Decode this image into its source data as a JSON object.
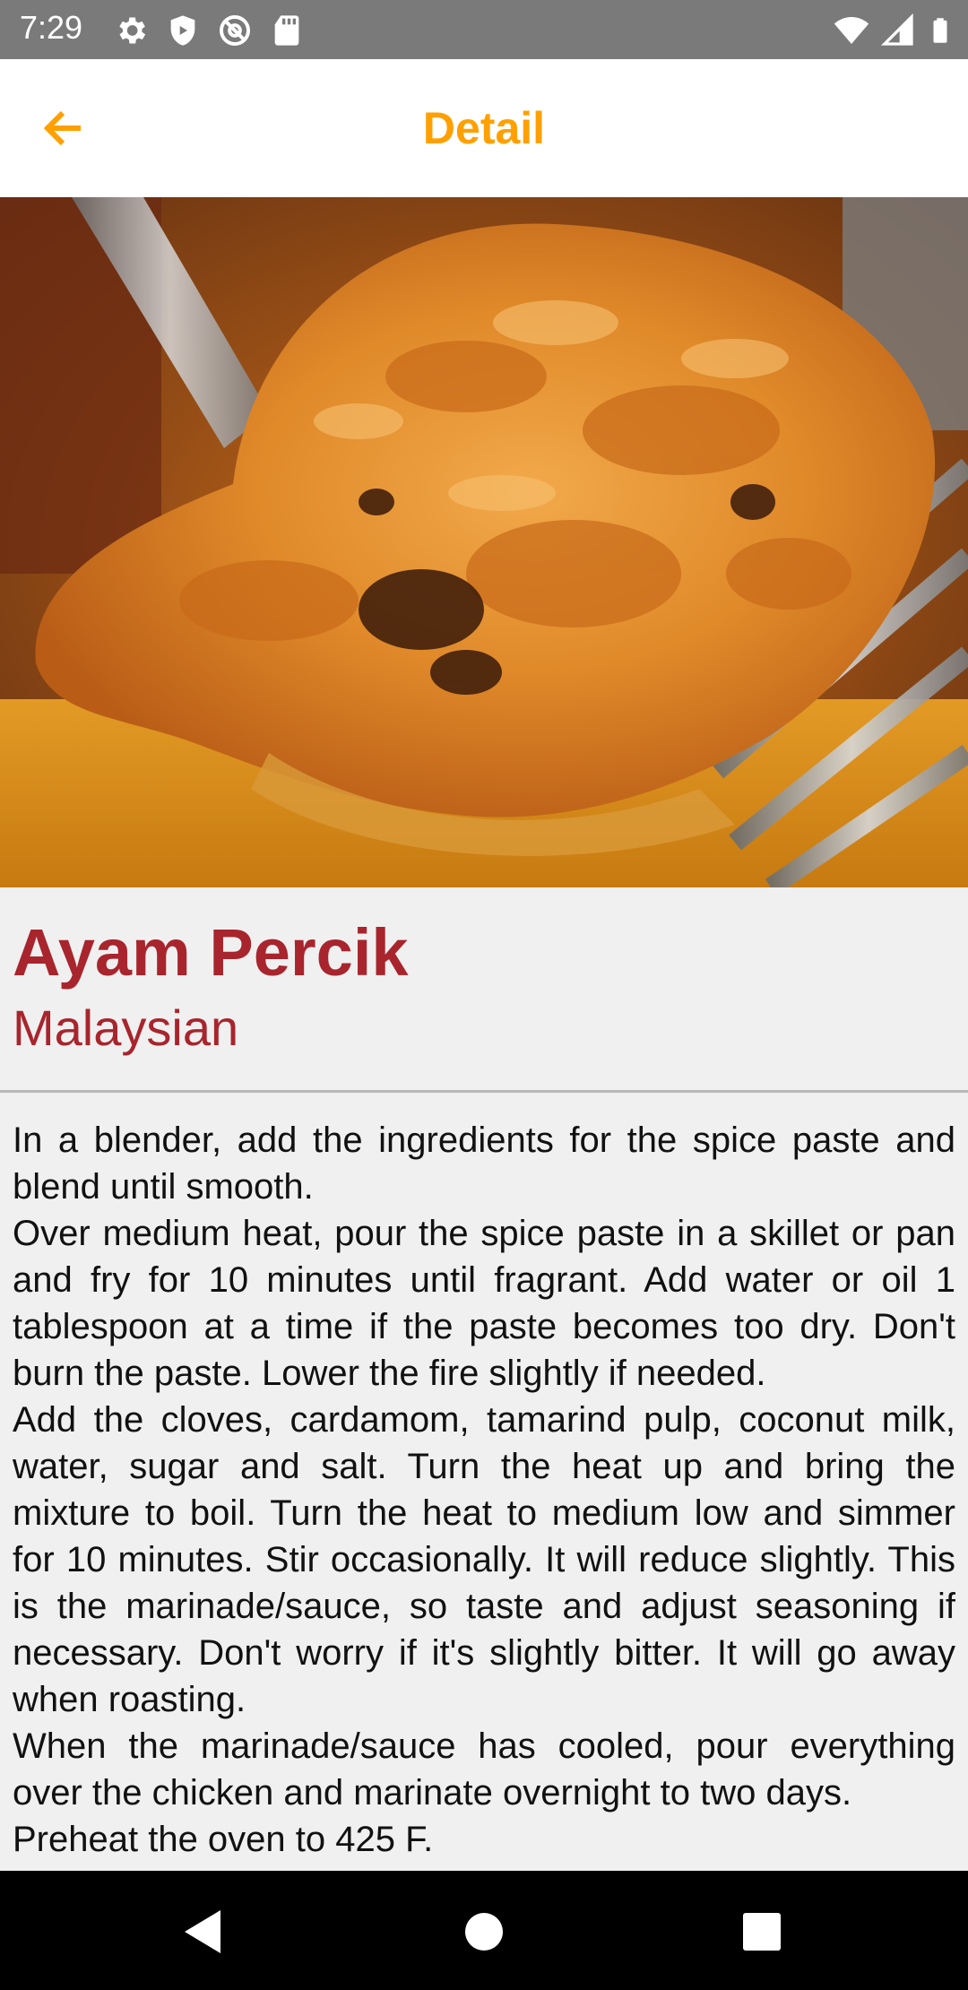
{
  "status_bar": {
    "time": "7:29",
    "left_icons": [
      "gear-icon",
      "shield-icon",
      "at-sign-icon",
      "sd-card-icon"
    ],
    "right_icons": [
      "wifi-icon",
      "cell-signal-icon",
      "battery-icon"
    ]
  },
  "app_bar": {
    "title": "Detail",
    "back_icon": "arrow-left-icon",
    "accent_color": "#ffa000"
  },
  "meal": {
    "name": "Ayam Percik",
    "area": "Malaysian",
    "title_color": "#a8252d",
    "image_description_icon": "food-photo"
  },
  "instructions": {
    "paragraphs": [
      "In a blender, add the ingredients for the spice paste and blend until smooth.",
      "Over medium heat, pour the spice paste in a skillet or pan and fry for 10 minutes until fragrant. Add water or oil 1 tablespoon at a time if the paste becomes too dry. Don't burn the paste. Lower the fire slightly if needed.",
      "Add the cloves, cardamom, tamarind pulp, coconut milk, water, sugar and salt. Turn the heat up and bring the mixture to boil. Turn the heat to medium low and simmer for 10 minutes. Stir occasionally. It will reduce slightly. This is the marinade/sauce, so taste and adjust seasoning if necessary. Don't worry if it's slightly bitter. It will go away when roasting.",
      "When the marinade/sauce has cooled, pour everything over the chicken and marinate overnight to two days.",
      "Preheat the oven to 425 F."
    ]
  },
  "nav_bar": {
    "icons": [
      "back-triangle-icon",
      "home-circle-icon",
      "recents-square-icon"
    ]
  }
}
